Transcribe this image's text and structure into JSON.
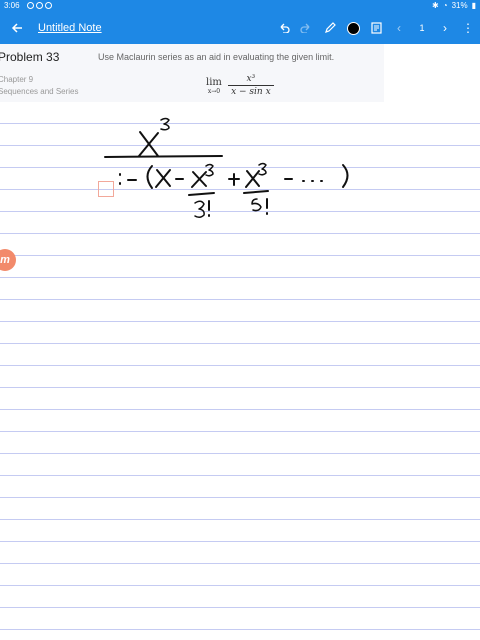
{
  "status_bar": {
    "time": "3:06",
    "battery": "31%"
  },
  "app_bar": {
    "title": "Untitled Note",
    "page_number": "1",
    "icons": [
      "back-arrow-icon",
      "undo-icon",
      "redo-icon",
      "pen-icon",
      "color-swatch-icon",
      "note-icon",
      "prev-page-icon",
      "next-page-icon",
      "more-icon"
    ],
    "pen_color": "#000000",
    "accent": "#1e88e5"
  },
  "problem": {
    "title": "Problem 33",
    "description": "Use Maclaurin series as an aid in evaluating the given limit.",
    "chapter": "Chapter 9",
    "section": "Sequences and Series",
    "formula": {
      "lim": "lim",
      "sub": "x→0",
      "numerator": "x³",
      "denominator": "x − sin x"
    }
  },
  "brand_badge": {
    "letter": "m"
  }
}
